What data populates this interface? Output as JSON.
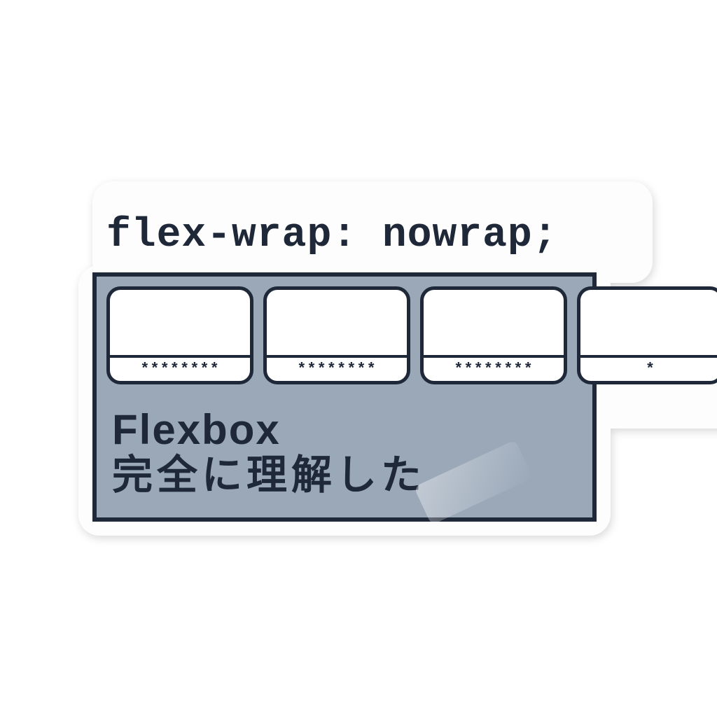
{
  "code": "flex-wrap: nowrap;",
  "items": [
    {
      "label": "********"
    },
    {
      "label": "********"
    },
    {
      "label": "********"
    },
    {
      "label": "*"
    }
  ],
  "text": {
    "line1": "Flexbox",
    "line2": "完全に理解した"
  },
  "colors": {
    "ink": "#1e2838",
    "container": "#9aa8b8",
    "card": "#ffffff",
    "paper": "#fdfdfd"
  }
}
